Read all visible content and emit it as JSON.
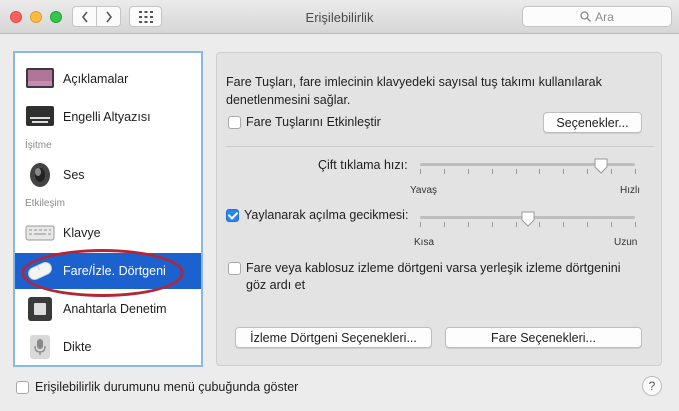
{
  "window": {
    "title": "Erişilebilirlik"
  },
  "search": {
    "placeholder": "Ara"
  },
  "sidebar": {
    "items": [
      {
        "label": "Açıklamalar"
      },
      {
        "label": "Engelli Altyazısı"
      },
      {
        "label": "Ses"
      },
      {
        "label": "Klavye"
      },
      {
        "label": "Fare/İzle. Dörtgeni"
      },
      {
        "label": "Anahtarla Denetim"
      },
      {
        "label": "Dikte"
      }
    ],
    "headers": {
      "hearing": "İşitme",
      "interaction": "Etkileşim"
    },
    "selected_index": 4
  },
  "main": {
    "description": "Fare Tuşları, fare imlecinin klavyedeki sayısal tuş takımı kullanılarak denetlenmesini sağlar.",
    "mouse_keys_checkbox": {
      "label": "Fare Tuşlarını Etkinleştir",
      "checked": false
    },
    "options_button": "Seçenekler...",
    "double_click": {
      "label": "Çift tıklama hızı:",
      "min_label": "Yavaş",
      "max_label": "Hızlı",
      "value": 0.84
    },
    "spring_loading": {
      "label": "Yaylanarak açılma gecikmesi:",
      "checked": true,
      "min_label": "Kısa",
      "max_label": "Uzun",
      "value": 0.5
    },
    "ignore_builtin": {
      "label_line1": "Fare veya kablosuz izleme dörtgeni varsa yerleşik izleme dörtgenini",
      "label_line2": "göz ardı et",
      "checked": false
    },
    "trackpad_options_button": "İzleme Dörtgeni Seçenekleri...",
    "mouse_options_button": "Fare Seçenekleri..."
  },
  "footer": {
    "show_in_menu_bar": "Erişilebilirlik durumunu menü çubuğunda göster",
    "help": "?"
  }
}
